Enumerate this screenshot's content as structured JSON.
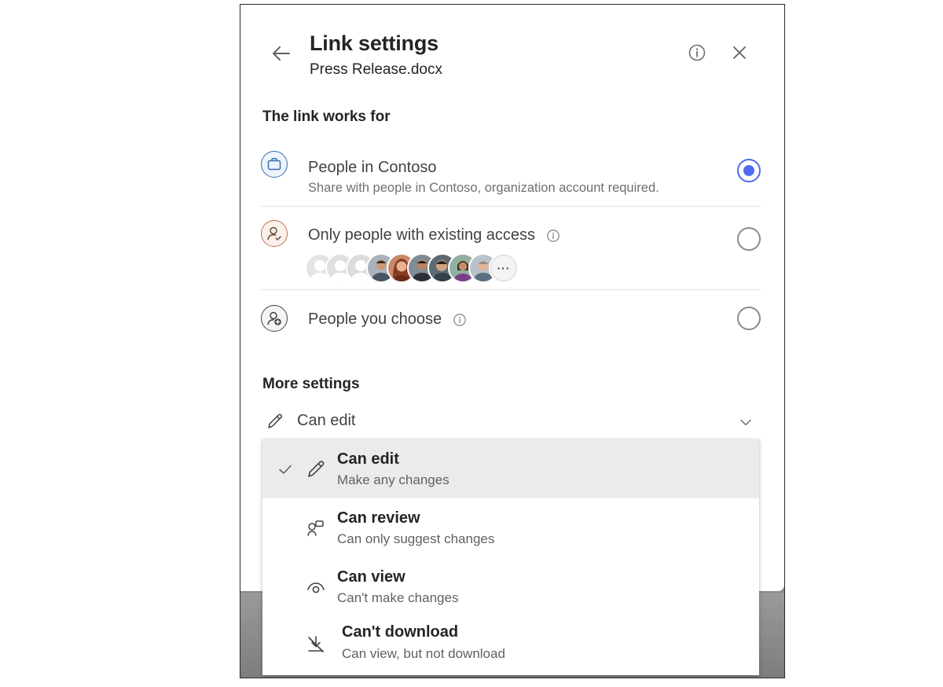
{
  "header": {
    "title": "Link settings",
    "file_name": "Press Release.docx",
    "back_icon": "arrow-left-icon",
    "info_icon": "info-icon",
    "close_icon": "close-icon"
  },
  "link_works_for": {
    "label": "The link works for",
    "options": [
      {
        "title": "People in Contoso",
        "description": "Share with people in Contoso, organization account required.",
        "icon": "briefcase-icon",
        "selected": true
      },
      {
        "title": "Only people with existing access",
        "icon": "person-check-icon",
        "selected": false,
        "more_label": "···"
      },
      {
        "title": "People you choose",
        "icon": "person-add-icon",
        "selected": false
      }
    ]
  },
  "more_settings": {
    "label": "More settings",
    "permission_value": "Can edit",
    "permission_icon": "pencil-icon",
    "chevron_icon": "chevron-down-icon"
  },
  "permission_menu": {
    "items": [
      {
        "title": "Can edit",
        "description": "Make any changes",
        "icon": "pencil-icon",
        "selected": true
      },
      {
        "title": "Can review",
        "description": "Can only suggest changes",
        "icon": "review-icon",
        "selected": false
      },
      {
        "title": "Can view",
        "description": "Can't make changes",
        "icon": "eye-icon",
        "selected": false
      },
      {
        "title": "Can't download",
        "description": "Can view, but not download",
        "icon": "no-download-icon",
        "selected": false
      }
    ]
  },
  "colors": {
    "accent": "#4f6bed",
    "briefcase_ring": "#3a6fb0",
    "person_check_ring": "#c0704a",
    "text_primary": "#242424",
    "text_secondary": "#707070",
    "selected_bg": "#ebebeb"
  }
}
